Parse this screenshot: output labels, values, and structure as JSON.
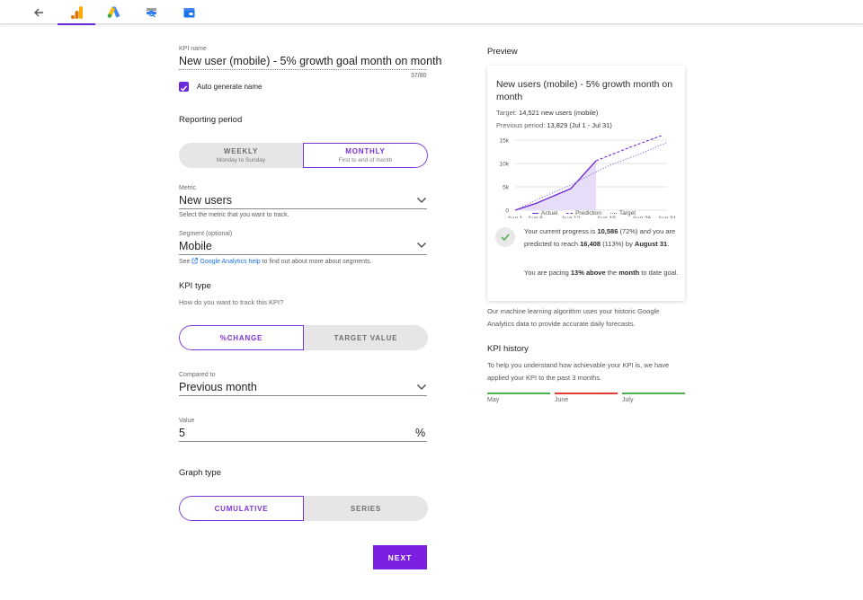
{
  "toolbar": {
    "items": [
      {
        "icon": "arrow-left-icon"
      },
      {
        "icon": "google-analytics-icon",
        "active": true
      },
      {
        "icon": "google-ads-icon"
      },
      {
        "icon": "search-console-icon"
      },
      {
        "icon": "my-business-icon"
      }
    ]
  },
  "form": {
    "kpi_name_label": "KPI name",
    "kpi_name_value": "New user (mobile) - 5% growth goal month on month",
    "kpi_name_counter": "37/80",
    "auto_generate_label": "Auto generate name",
    "auto_generate_checked": true,
    "reporting_period_title": "Reporting period",
    "period_weekly": "WEEKLY",
    "period_weekly_sub": "Monday to Sunday",
    "period_monthly": "MONTHLY",
    "period_monthly_sub": "First to end of month",
    "metric_label": "Metric",
    "metric_value": "New users",
    "metric_hint": "Select the metric that you want to track.",
    "segment_label": "Segment (optional)",
    "segment_value": "Mobile",
    "segment_hint_pre": "See",
    "segment_hint_link": "Google Analytics help",
    "segment_hint_post": "to find out about more about segments.",
    "kpi_type_title": "KPI type",
    "kpi_type_sub": "How do you want to track this KPI?",
    "kpi_type_change": "%CHANGE",
    "kpi_type_target": "TARGET VALUE",
    "compared_label": "Compared to",
    "compared_value": "Previous month",
    "value_label": "Value",
    "value_value": "5",
    "value_unit": "%",
    "graph_type_title": "Graph type",
    "graph_cumulative": "CUMULATIVE",
    "graph_series": "SERIES",
    "next_label": "NEXT"
  },
  "preview": {
    "title": "Preview",
    "card_title": "New users (mobile) - 5% growth month on month",
    "target_label": "Target:",
    "target_value": "14,521 new users (mobile)",
    "previous_label": "Previous period:",
    "previous_value": "13,829 (Jul 1 - Jul 31)",
    "progress_1": "Your current progress is",
    "progress_value": "10,586",
    "progress_pct": "(72%) and you are predicted to reach",
    "predicted_value": "16,408",
    "predicted_pct": "(113%) by",
    "predicted_date": "August 31",
    "pacing_1": "You are pacing",
    "pacing_value": "13% above",
    "pacing_2": "the",
    "pacing_month": "month",
    "pacing_3": "to date goal.",
    "ml_note": "Our machine learning algorithm uses your historic Google Analytics data to provide accurate daily forecasts.",
    "history_title": "KPI history",
    "history_text": "To help you understand how achievable your KPI is, we have applied your KPI to the past 3 months.",
    "history_months": [
      {
        "label": "May",
        "color": "#4caf50"
      },
      {
        "label": "June",
        "color": "#e53935"
      },
      {
        "label": "July",
        "color": "#4caf50"
      }
    ]
  },
  "chart_data": {
    "type": "line",
    "yticks": [
      "15k",
      "10k",
      "5k",
      "0"
    ],
    "xticks": [
      "Aug 1",
      "Aug 5",
      "Aug 12",
      "Aug 19",
      "Aug 26",
      "Aug 31"
    ],
    "ylim": [
      0,
      15000
    ],
    "legend": [
      "Actual",
      "Prediction",
      "Target"
    ],
    "series": [
      {
        "name": "Actual",
        "style": "solid",
        "color": "#6c2bd9",
        "points": [
          [
            1,
            0
          ],
          [
            5,
            1400
          ],
          [
            12,
            4600
          ],
          [
            17,
            10586
          ]
        ]
      },
      {
        "name": "Prediction",
        "style": "dashed",
        "color": "#6c2bd9",
        "points": [
          [
            17,
            10586
          ],
          [
            24,
            13600
          ],
          [
            31,
            16408
          ]
        ]
      },
      {
        "name": "Target",
        "style": "dotted",
        "color": "#8a74c9",
        "points": [
          [
            1,
            0
          ],
          [
            5,
            2100
          ],
          [
            12,
            5400
          ],
          [
            19,
            9300
          ],
          [
            26,
            12200
          ],
          [
            31,
            14521
          ]
        ]
      }
    ]
  },
  "colors": {
    "accent": "#7b34dc",
    "next_button": "#7b1fe0",
    "success": "#4caf50",
    "danger": "#e53935"
  }
}
